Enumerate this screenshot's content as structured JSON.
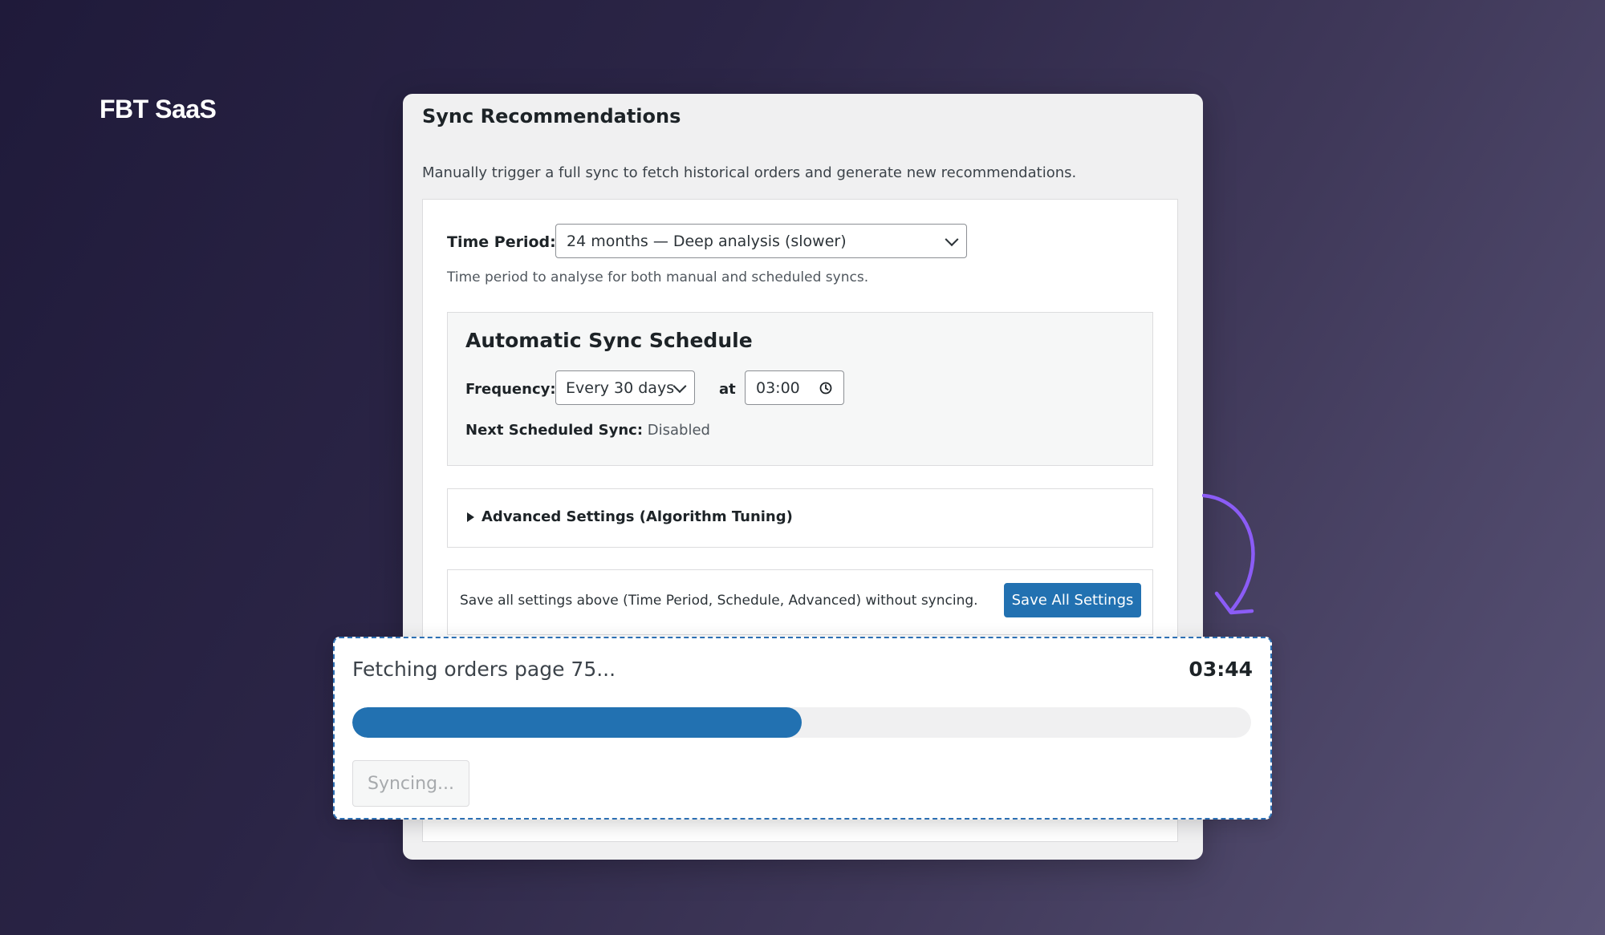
{
  "brand": "FBT SaaS",
  "panel": {
    "title": "Sync Recommendations",
    "description": "Manually trigger a full sync to fetch historical orders and generate new recommendations."
  },
  "time_period": {
    "label": "Time Period:",
    "selected": "24 months — Deep analysis (slower)",
    "help": "Time period to analyse for both manual and scheduled syncs."
  },
  "schedule": {
    "title": "Automatic Sync Schedule",
    "frequency_label": "Frequency:",
    "frequency_selected": "Every 30 days",
    "at_label": "at",
    "time_value": "03:00",
    "next_label": "Next Scheduled Sync:",
    "next_value": "Disabled"
  },
  "advanced": {
    "label": "Advanced Settings (Algorithm Tuning)"
  },
  "save": {
    "text": "Save all settings above (Time Period, Schedule, Advanced) without syncing.",
    "button": "Save All Settings"
  },
  "progress": {
    "status": "Fetching orders page 75...",
    "elapsed": "03:44",
    "percent": 50,
    "button": "Syncing..."
  },
  "colors": {
    "accent": "#2271b1",
    "arrow": "#8b5cf6"
  },
  "icons": {
    "chevron": "chevron-down-icon",
    "clock": "clock-icon",
    "disclosure": "triangle-right-icon",
    "curl_arrow": "curved-arrow-icon"
  }
}
